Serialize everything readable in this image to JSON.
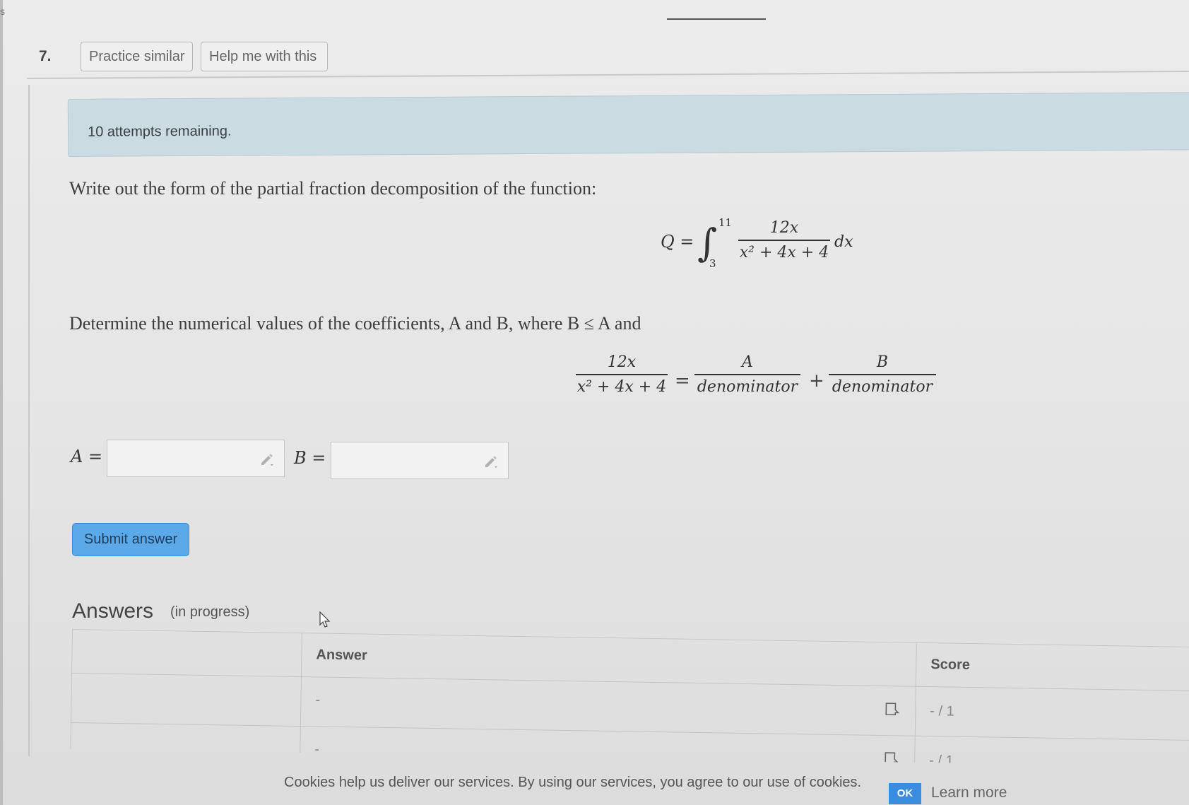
{
  "page": {
    "corner_char": "s",
    "question_number": "7."
  },
  "toolbar": {
    "practice_similar": "Practice similar",
    "help_me": "Help me with this"
  },
  "attempts_banner": "10 attempts remaining.",
  "prompt": {
    "line1": "Write out the form of the partial fraction decomposition of the function:",
    "line2": "Determine the numerical values of the coefficients, A and B, where B ≤ A and"
  },
  "equation1": {
    "lhs": "Q =",
    "integral_sign": "∫",
    "upper_limit": "11",
    "lower_limit": "3",
    "numerator": "12x",
    "denominator": "x² + 4x + 4",
    "differential": "dx"
  },
  "equation2": {
    "lhs_numerator": "12x",
    "lhs_denominator": "x² + 4x + 4",
    "equals": "=",
    "term1_numerator": "A",
    "term1_denominator": "denominator",
    "plus": "+",
    "term2_numerator": "B",
    "term2_denominator": "denominator"
  },
  "inputs": {
    "a_label": "A =",
    "a_value": "",
    "b_label": "B =",
    "b_value": ""
  },
  "submit_label": "Submit answer",
  "answers": {
    "title": "Answers",
    "subtitle": "(in progress)",
    "columns": [
      "",
      "Answer",
      "Score"
    ],
    "rows": [
      {
        "label": "",
        "answer": "-",
        "score": "- / 1"
      },
      {
        "label": "",
        "answer": "-",
        "score": "- / 1"
      }
    ]
  },
  "cookie": {
    "text": "Cookies help us deliver our services. By using our services, you agree to our use of cookies.",
    "ok": "OK",
    "learn_more": "Learn more"
  },
  "icons": [
    "pencil-icon",
    "feedback-icon",
    "cursor-icon"
  ]
}
